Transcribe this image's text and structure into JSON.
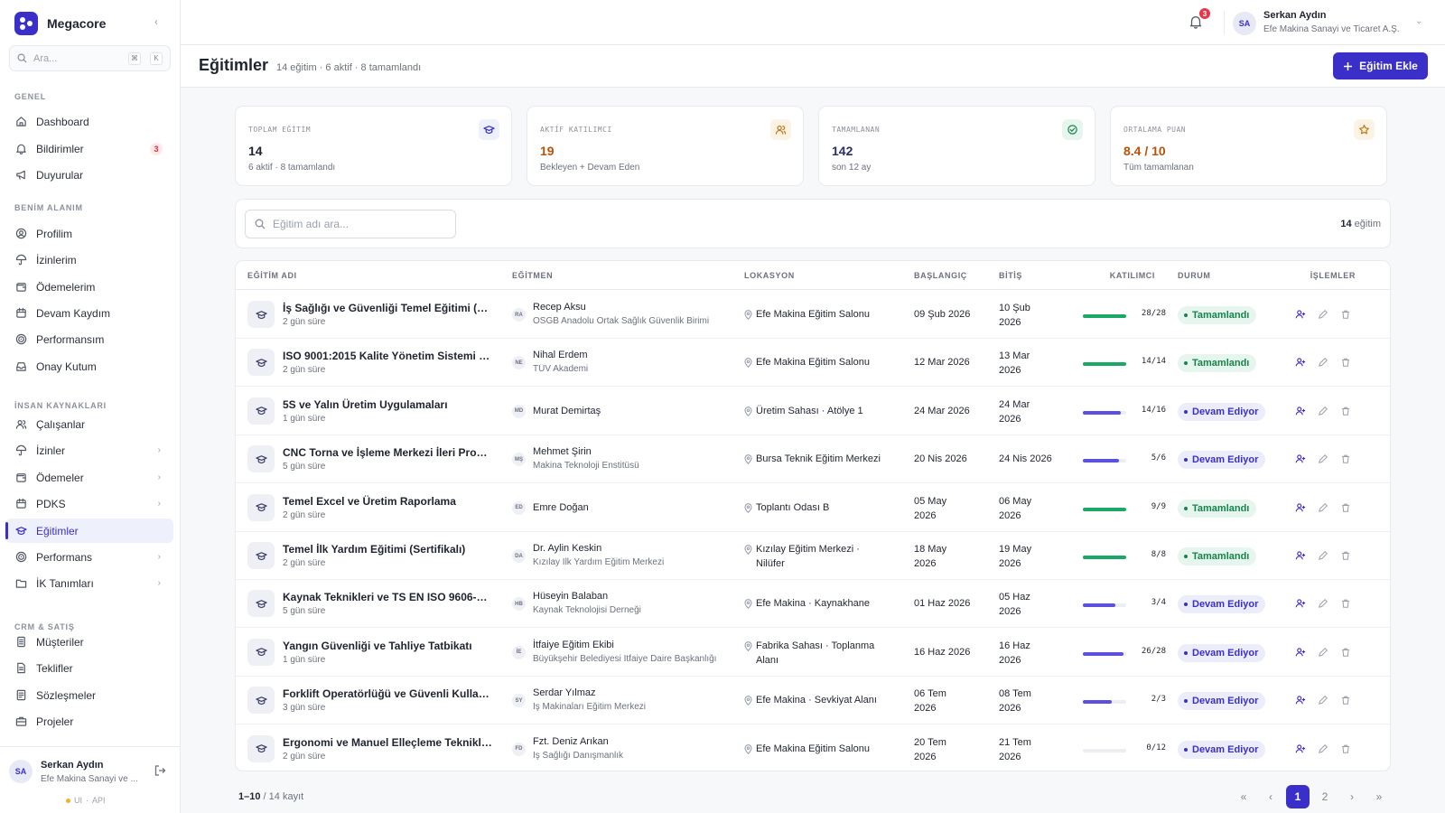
{
  "app": {
    "name": "Megacore"
  },
  "sidebar": {
    "search_placeholder": "Ara...",
    "shortcut_keys": [
      "⌘",
      "K"
    ],
    "sections": {
      "general": "GENEL",
      "my_area": "BENİM ALANIM",
      "hr": "İNSAN KAYNAKLARI",
      "crm": "CRM & SATIŞ"
    },
    "items": [
      {
        "label": "Dashboard",
        "icon": "home-icon"
      },
      {
        "label": "Bildirimler",
        "icon": "bell-icon",
        "badge": "3"
      },
      {
        "label": "Duyurular",
        "icon": "megaphone-icon"
      },
      {
        "label": "Profilim",
        "icon": "user-circle-icon"
      },
      {
        "label": "İzinlerim",
        "icon": "umbrella-icon"
      },
      {
        "label": "Ödemelerim",
        "icon": "wallet-icon"
      },
      {
        "label": "Devam Kaydım",
        "icon": "calendar-icon"
      },
      {
        "label": "Performansım",
        "icon": "target-icon"
      },
      {
        "label": "Onay Kutum",
        "icon": "inbox-icon"
      },
      {
        "label": "Çalışanlar",
        "icon": "users-icon"
      },
      {
        "label": "İzinler",
        "icon": "umbrella-icon"
      },
      {
        "label": "Ödemeler",
        "icon": "wallet-icon"
      },
      {
        "label": "PDKS",
        "icon": "calendar-icon"
      },
      {
        "label": "Eğitimler",
        "icon": "graduation-cap-icon",
        "active": true
      },
      {
        "label": "Performans",
        "icon": "target-icon"
      },
      {
        "label": "İK Tanımları",
        "icon": "folder-icon"
      },
      {
        "label": "Müşteriler",
        "icon": "building-icon"
      },
      {
        "label": "Teklifler",
        "icon": "document-icon"
      },
      {
        "label": "Sözleşmeler",
        "icon": "contract-icon"
      },
      {
        "label": "Projeler",
        "icon": "briefcase-icon"
      }
    ],
    "footer": {
      "initials": "SA",
      "name": "Serkan Aydın",
      "org": "Efe Makina Sanayi ve ...",
      "status_ui": "UI",
      "status_sep": "·",
      "status_api": "API"
    }
  },
  "topbar": {
    "notification_count": "3",
    "user_initials": "SA",
    "user_name": "Serkan Aydın",
    "user_org": "Efe Makina Sanayi ve Ticaret A.Ş."
  },
  "header": {
    "title": "Eğitimler",
    "subtitle": "14 eğitim · 6 aktif · 8 tamamlandı",
    "add_button": "Eğitim Ekle"
  },
  "stats": [
    {
      "label": "TOPLAM EĞİTİM",
      "value": "14",
      "hint": "6 aktif · 8 tamamlandı",
      "icon": "graduation-cap-icon",
      "color": "#1f2430",
      "icon_bg": "#eef0fb",
      "icon_color": "#3b2fc9"
    },
    {
      "label": "AKTİF KATILIMCI",
      "value": "19",
      "hint": "Bekleyen + Devam Eden",
      "icon": "users-icon",
      "color": "#b45309",
      "icon_bg": "#fdf3e4",
      "icon_color": "#c27a1a"
    },
    {
      "label": "TAMAMLANAN",
      "value": "142",
      "hint": "son 12 ay",
      "icon": "check-circle-icon",
      "color": "#2a2f66",
      "icon_bg": "#e6f6ee",
      "icon_color": "#16844a"
    },
    {
      "label": "ORTALAMA PUAN",
      "value": "8.4 / 10",
      "hint": "Tüm tamamlanan",
      "icon": "star-icon",
      "color": "#b45309",
      "icon_bg": "#fdf3e4",
      "icon_color": "#c27a1a"
    }
  ],
  "filter": {
    "search_placeholder": "Eğitim adı ara...",
    "count": "14",
    "count_suffix": "eğitim"
  },
  "table": {
    "columns": [
      "EĞİTİM ADI",
      "EĞİTMEN",
      "LOKASYON",
      "BAŞLANGIÇ",
      "BİTİŞ",
      "KATILIMCI",
      "DURUM",
      "İŞLEMLER"
    ],
    "rows": [
      {
        "name": "İş Sağlığı ve Güvenliği Temel Eğitimi (Az...",
        "duration": "2 gün süre",
        "ins_initials": "RA",
        "instructor": "Recep Aksu",
        "ins_org": "OSGB Anadolu Ortak Sağlık Güvenlik Birimi",
        "location": [
          "Efe Makina Eğitim Salonu"
        ],
        "start": [
          "09 Şub 2026"
        ],
        "end": [
          "10 Şub",
          "2026"
        ],
        "participants": "28/28",
        "ratio": 1.0,
        "status": "Tamamlandı",
        "status_type": "done"
      },
      {
        "name": "ISO 9001:2015 Kalite Yönetim Sistemi F...",
        "duration": "2 gün süre",
        "ins_initials": "NE",
        "instructor": "Nihal Erdem",
        "ins_org": "TÜV Akademi",
        "location": [
          "Efe Makina Eğitim Salonu"
        ],
        "start": [
          "12 Mar 2026"
        ],
        "end": [
          "13 Mar",
          "2026"
        ],
        "participants": "14/14",
        "ratio": 1.0,
        "status": "Tamamlandı",
        "status_type": "done"
      },
      {
        "name": "5S ve Yalın Üretim Uygulamaları",
        "duration": "1 gün süre",
        "ins_initials": "MD",
        "instructor": "Murat Demirtaş",
        "ins_org": "",
        "location": [
          "Üretim Sahası · Atölye 1"
        ],
        "start": [
          "24 Mar 2026"
        ],
        "end": [
          "24 Mar",
          "2026"
        ],
        "participants": "14/16",
        "ratio": 0.875,
        "status": "Devam Ediyor",
        "status_type": "ongoing"
      },
      {
        "name": "CNC Torna ve İşleme Merkezi İleri Progr...",
        "duration": "5 gün süre",
        "ins_initials": "MŞ",
        "instructor": "Mehmet Şirin",
        "ins_org": "Makina Teknoloji Enstitüsü",
        "location": [
          "Bursa Teknik Eğitim Merkezi"
        ],
        "start": [
          "20 Nis 2026"
        ],
        "end": [
          "24 Nis 2026"
        ],
        "participants": "5/6",
        "ratio": 0.833,
        "status": "Devam Ediyor",
        "status_type": "ongoing"
      },
      {
        "name": "Temel Excel ve Üretim Raporlama",
        "duration": "2 gün süre",
        "ins_initials": "ED",
        "instructor": "Emre Doğan",
        "ins_org": "",
        "location": [
          "Toplantı Odası B"
        ],
        "start": [
          "05 May",
          "2026"
        ],
        "end": [
          "06 May",
          "2026"
        ],
        "participants": "9/9",
        "ratio": 1.0,
        "status": "Tamamlandı",
        "status_type": "done"
      },
      {
        "name": "Temel İlk Yardım Eğitimi (Sertifikalı)",
        "duration": "2 gün süre",
        "ins_initials": "DA",
        "instructor": "Dr. Aylin Keskin",
        "ins_org": "Kızılay İlk Yardım Eğitim Merkezi",
        "location": [
          "Kızılay Eğitim Merkezi ·",
          "Nilüfer"
        ],
        "start": [
          "18 May",
          "2026"
        ],
        "end": [
          "19 May",
          "2026"
        ],
        "participants": "8/8",
        "ratio": 1.0,
        "status": "Tamamlandı",
        "status_type": "done"
      },
      {
        "name": "Kaynak Teknikleri ve TS EN ISO 9606-1 ...",
        "duration": "5 gün süre",
        "ins_initials": "HB",
        "instructor": "Hüseyin Balaban",
        "ins_org": "Kaynak Teknolojisi Derneği",
        "location": [
          "Efe Makina · Kaynakhane"
        ],
        "start": [
          "01 Haz 2026"
        ],
        "end": [
          "05 Haz",
          "2026"
        ],
        "participants": "3/4",
        "ratio": 0.75,
        "status": "Devam Ediyor",
        "status_type": "ongoing"
      },
      {
        "name": "Yangın Güvenliği ve Tahliye Tatbikatı",
        "duration": "1 gün süre",
        "ins_initials": "İE",
        "instructor": "İtfaiye Eğitim Ekibi",
        "ins_org": "Büyükşehir Belediyesi İtfaiye Daire Başkanlığı",
        "location": [
          "Fabrika Sahası · Toplanma",
          "Alanı"
        ],
        "start": [
          "16 Haz 2026"
        ],
        "end": [
          "16 Haz",
          "2026"
        ],
        "participants": "26/28",
        "ratio": 0.929,
        "status": "Devam Ediyor",
        "status_type": "ongoing"
      },
      {
        "name": "Forklift Operatörlüğü ve Güvenli Kullanım",
        "duration": "3 gün süre",
        "ins_initials": "SY",
        "instructor": "Serdar Yılmaz",
        "ins_org": "İş Makinaları Eğitim Merkezi",
        "location": [
          "Efe Makina · Sevkiyat Alanı"
        ],
        "start": [
          "06 Tem",
          "2026"
        ],
        "end": [
          "08 Tem",
          "2026"
        ],
        "participants": "2/3",
        "ratio": 0.667,
        "status": "Devam Ediyor",
        "status_type": "ongoing"
      },
      {
        "name": "Ergonomi ve Manuel Elleçleme Teknikleri",
        "duration": "2 gün süre",
        "ins_initials": "FD",
        "instructor": "Fzt. Deniz Arıkan",
        "ins_org": "İş Sağlığı Danışmanlık",
        "location": [
          "Efe Makina Eğitim Salonu"
        ],
        "start": [
          "20 Tem",
          "2026"
        ],
        "end": [
          "21 Tem",
          "2026"
        ],
        "participants": "0/12",
        "ratio": 0.0,
        "status": "Devam Ediyor",
        "status_type": "ongoing"
      }
    ]
  },
  "pagination": {
    "range": "1–10",
    "total": "/ 14 kayıt",
    "pages": [
      "1",
      "2"
    ],
    "current": "1",
    "first": "«",
    "prev": "‹",
    "next": "›",
    "last": "»"
  },
  "colors": {
    "accent": "#3b2fc9",
    "success": "#16844a",
    "progress_done": "#1aa866",
    "progress_ongoing": "#5b50e0"
  }
}
